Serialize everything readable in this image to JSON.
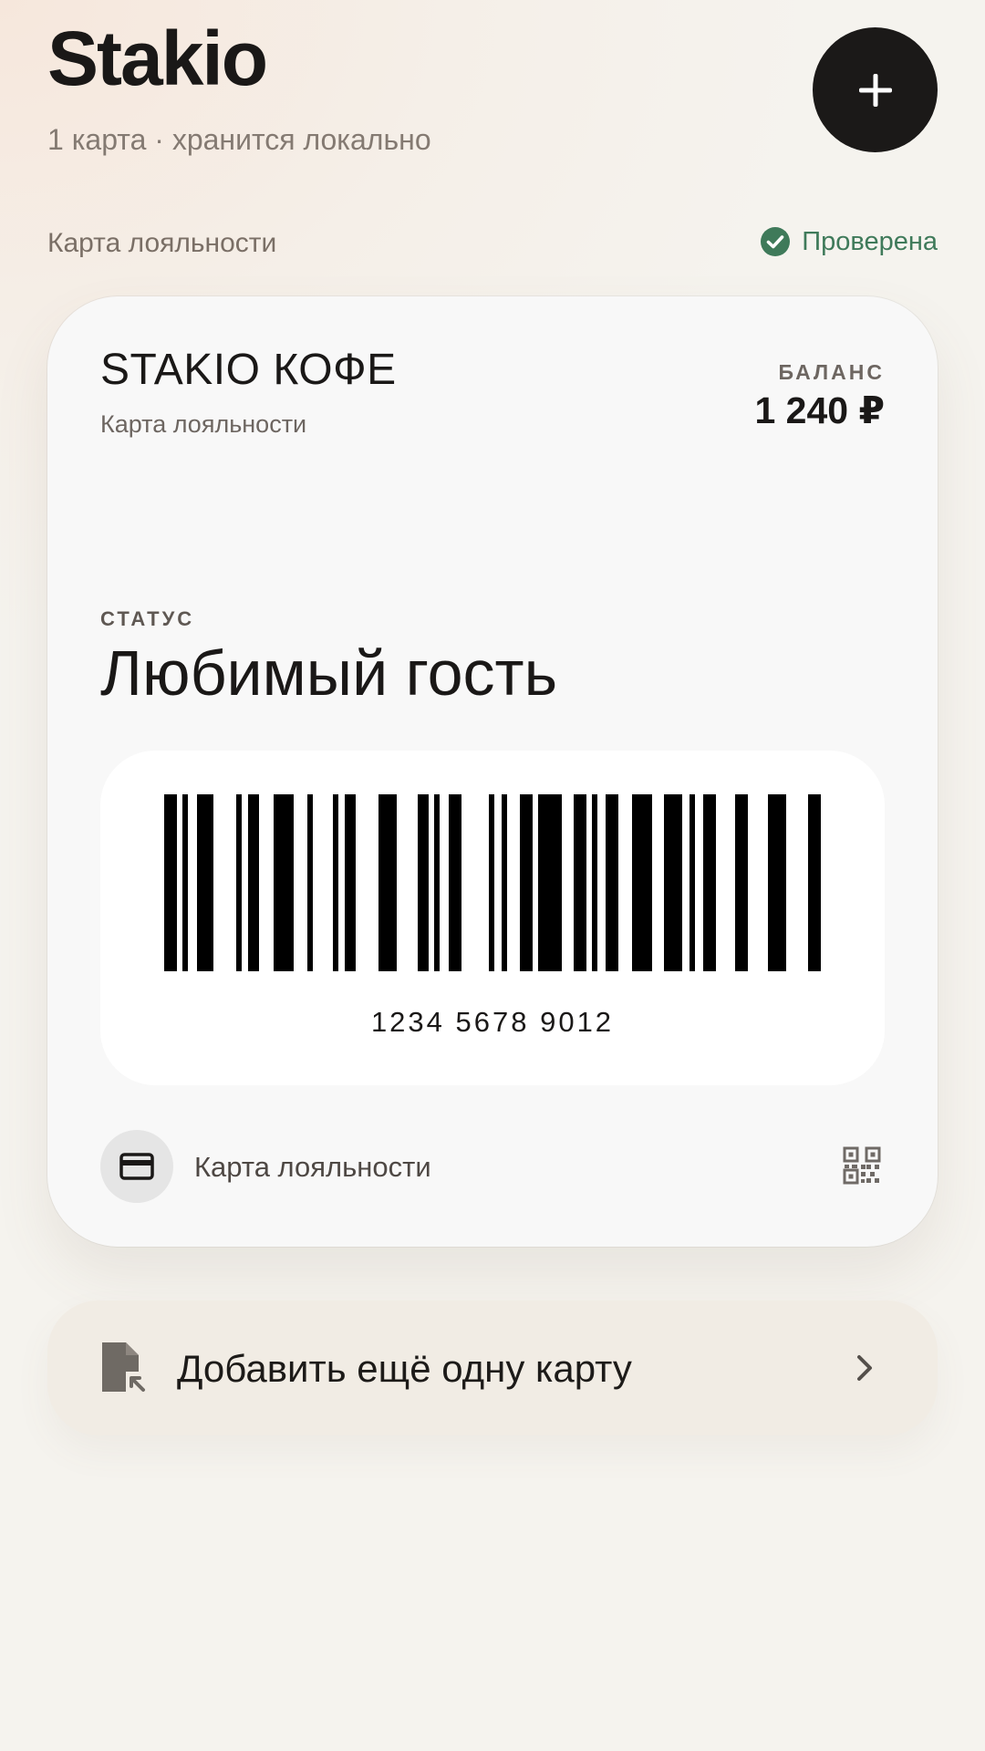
{
  "header": {
    "title": "Stakio",
    "subtitle": "1 карта · хранится локально",
    "add_icon": "plus-icon"
  },
  "section": {
    "label": "Карта лояльности",
    "verified_label": "Проверена",
    "verified_icon": "check-circle-icon",
    "verified_color": "#3f7a5a"
  },
  "card": {
    "merchant": "STAKIO КОФЕ",
    "type": "Карта лояльности",
    "balance_label": "БАЛАНС",
    "balance_value": "1 240 ₽",
    "status_label": "СТАТУС",
    "status_value": "Любимый гость",
    "barcode_number": "1234 5678 9012",
    "footer_icon": "credit-card-icon",
    "footer_label": "Карта лояльности",
    "qr_icon": "qr-code-icon",
    "background": "#f8f8f8"
  },
  "add_card_row": {
    "label": "Добавить ещё одну карту",
    "icon": "file-import-icon",
    "chevron_icon": "chevron-right-icon"
  }
}
